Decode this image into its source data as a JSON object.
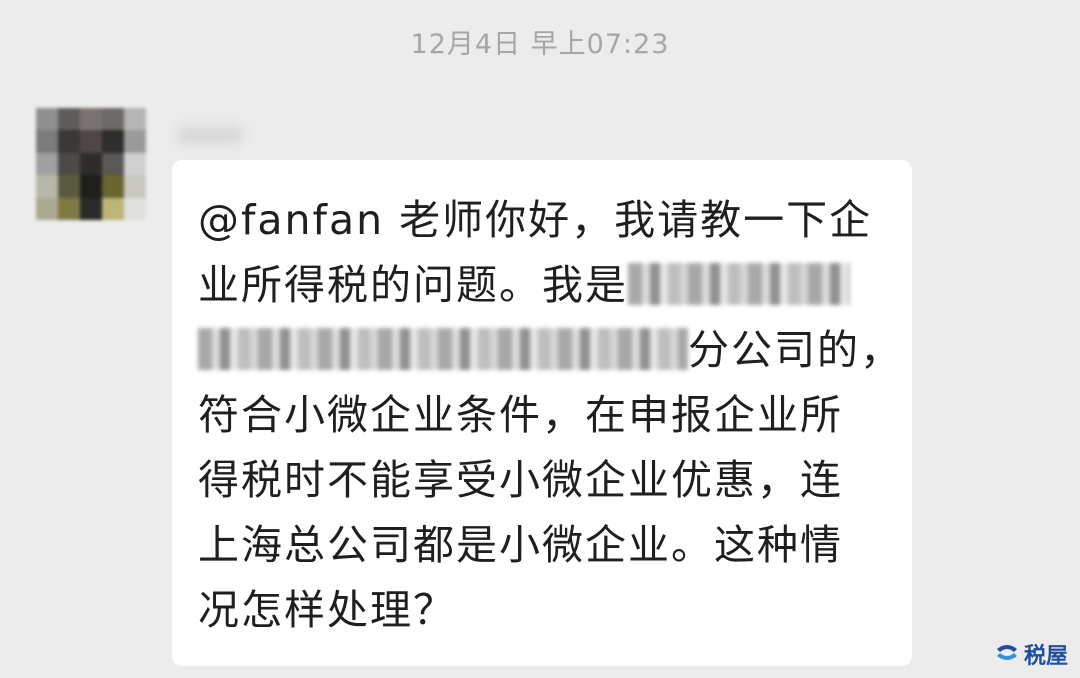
{
  "chat": {
    "timestamp": "12月4日 早上07:23",
    "message": {
      "lines": [
        "@fanfan 老师你好，我请教一下企",
        "业所得税的问题。我是",
        "分公司的，",
        "符合小微企业条件，在申报企业所",
        "得税时不能享受小微企业优惠，连",
        "上海总公司都是小微企业。这种情",
        "况怎样处理？"
      ]
    }
  },
  "watermark": {
    "label": "税屋",
    "color": "#1d4f9c"
  },
  "avatar": {
    "pixels": [
      "#8f8f8f",
      "#5f5d5b",
      "#7a7270",
      "#6d6a67",
      "#b5b5b5",
      "#7c7c7c",
      "#3a3836",
      "#4e4744",
      "#2f2d2b",
      "#9a9a9a",
      "#a0a0a0",
      "#4c4a48",
      "#2e2c2a",
      "#5a5856",
      "#d0d0d0",
      "#b8b8a8",
      "#5c5a3e",
      "#1e1e1c",
      "#6a6530",
      "#c8c8c0",
      "#a8a890",
      "#7e7a46",
      "#2a2a28",
      "#bcb478",
      "#e0e0dc"
    ]
  }
}
